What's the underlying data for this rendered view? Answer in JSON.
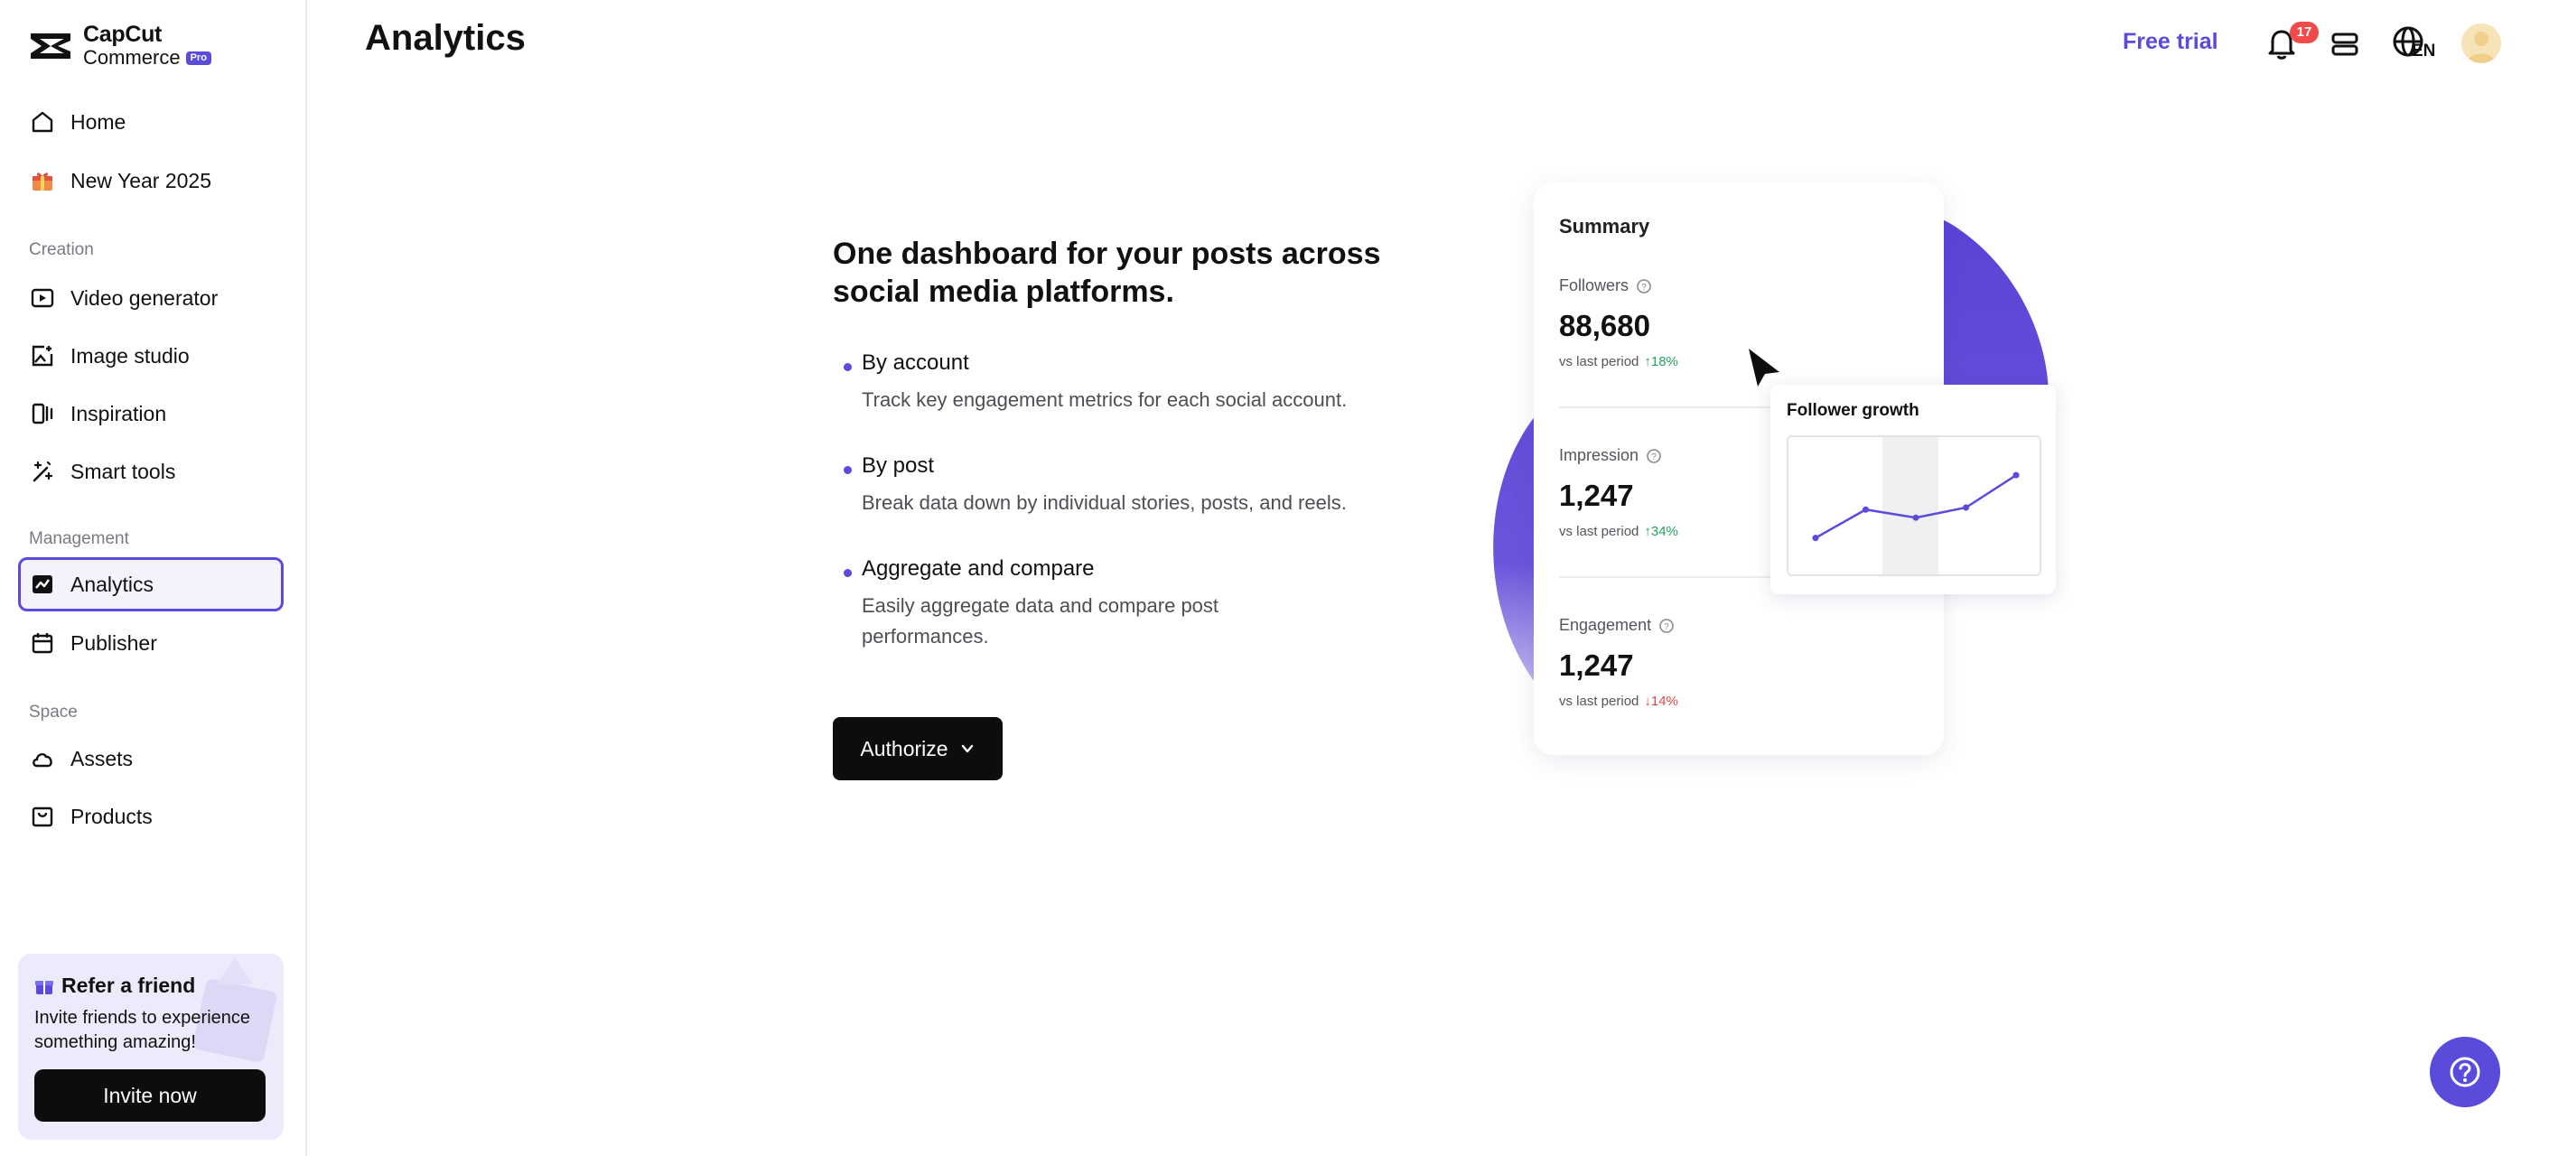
{
  "app": {
    "logo_line1": "CapCut",
    "logo_line2": "Commerce",
    "logo_badge": "Pro",
    "accent_color": "#5b4bdb"
  },
  "sidebar": {
    "top_items": [
      {
        "label": "Home",
        "icon": "home-icon"
      },
      {
        "label": "New Year 2025",
        "icon": "gift-box-icon"
      }
    ],
    "sections": [
      {
        "label": "Creation",
        "items": [
          {
            "label": "Video generator",
            "icon": "video-play-icon"
          },
          {
            "label": "Image studio",
            "icon": "image-edit-icon"
          },
          {
            "label": "Inspiration",
            "icon": "inspiration-icon"
          },
          {
            "label": "Smart tools",
            "icon": "magic-wand-icon"
          }
        ]
      },
      {
        "label": "Management",
        "items": [
          {
            "label": "Analytics",
            "icon": "analytics-icon",
            "active": true
          },
          {
            "label": "Publisher",
            "icon": "calendar-icon"
          }
        ]
      },
      {
        "label": "Space",
        "items": [
          {
            "label": "Assets",
            "icon": "cloud-icon"
          },
          {
            "label": "Products",
            "icon": "product-bag-icon"
          }
        ]
      }
    ],
    "refer": {
      "title": "Refer a friend",
      "description": "Invite friends to experience something amazing!",
      "button_label": "Invite now"
    }
  },
  "header": {
    "title": "Analytics",
    "free_trial_label": "Free trial",
    "notification_count": "17",
    "language": "EN"
  },
  "main": {
    "headline": "One dashboard for your posts across social media platforms.",
    "features": [
      {
        "title": "By account",
        "description": "Track key engagement metrics for each social account."
      },
      {
        "title": "By post",
        "description": "Break data down by individual stories, posts, and reels."
      },
      {
        "title": "Aggregate and compare",
        "description": "Easily aggregate data and compare post performances."
      }
    ],
    "authorize_label": "Authorize"
  },
  "illustration": {
    "summary_title": "Summary",
    "metrics": [
      {
        "label": "Followers",
        "value": "88,680",
        "comparison": "vs last period",
        "change": "↑18%",
        "direction": "up"
      },
      {
        "label": "Impression",
        "value": "1,247",
        "comparison": "vs last period",
        "change": "↑34%",
        "direction": "up"
      },
      {
        "label": "Engagement",
        "value": "1,247",
        "comparison": "vs last period",
        "change": "↓14%",
        "direction": "down"
      }
    ],
    "growth_title": "Follower growth",
    "growth_points": [
      0.2,
      0.48,
      0.4,
      0.5,
      0.82
    ]
  }
}
